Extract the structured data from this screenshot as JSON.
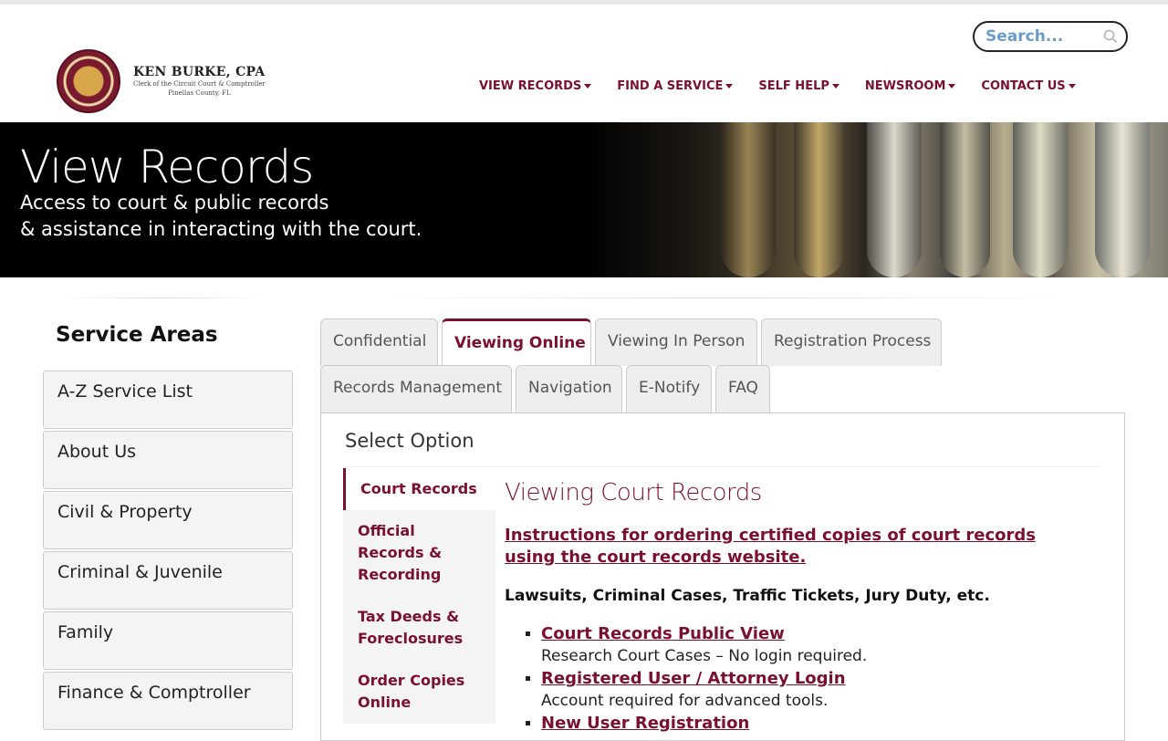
{
  "header": {
    "logo_name": "KEN BURKE, CPA",
    "logo_line1": "Clerk of the Circuit Court & Comptroller",
    "logo_line2": "Pinellas County, FL",
    "search_placeholder": "Search..."
  },
  "nav": [
    "VIEW RECORDS",
    "FIND A SERVICE",
    "SELF HELP",
    "NEWSROOM",
    "CONTACT US"
  ],
  "hero": {
    "title": "View Records",
    "subtitle_line1": "Access to court & public records",
    "subtitle_line2": "& assistance in interacting with the court."
  },
  "sidebar": {
    "title": "Service Areas",
    "items": [
      "A-Z Service List",
      "About Us",
      "Civil & Property",
      "Criminal & Juvenile",
      "Family",
      "Finance & Comptroller"
    ]
  },
  "tabs": {
    "row1": [
      "Confidential",
      "Viewing Online",
      "Viewing In Person",
      "Registration Process"
    ],
    "row2": [
      "Records Management",
      "Navigation",
      "E-Notify",
      "FAQ"
    ],
    "active": "Viewing Online"
  },
  "panel": {
    "title": "Select Option",
    "subnav": [
      "Court Records",
      "Official Records & Recording",
      "Tax Deeds & Foreclosures",
      "Order Copies Online"
    ],
    "content_title": "Viewing Court Records",
    "instructions_link": "Instructions for ordering certified copies of court records using the court records website.",
    "lead": "Lawsuits, Criminal Cases, Traffic Tickets, Jury Duty, etc.",
    "links": [
      {
        "label": "Court Records Public View",
        "desc": "Research Court Cases – No login required."
      },
      {
        "label": "Registered User / Attorney Login",
        "desc": "Account required for advanced tools."
      },
      {
        "label": "New User Registration",
        "desc": ""
      }
    ]
  },
  "colors": {
    "brand": "#7a1030",
    "search_text": "#6a9cc8"
  }
}
